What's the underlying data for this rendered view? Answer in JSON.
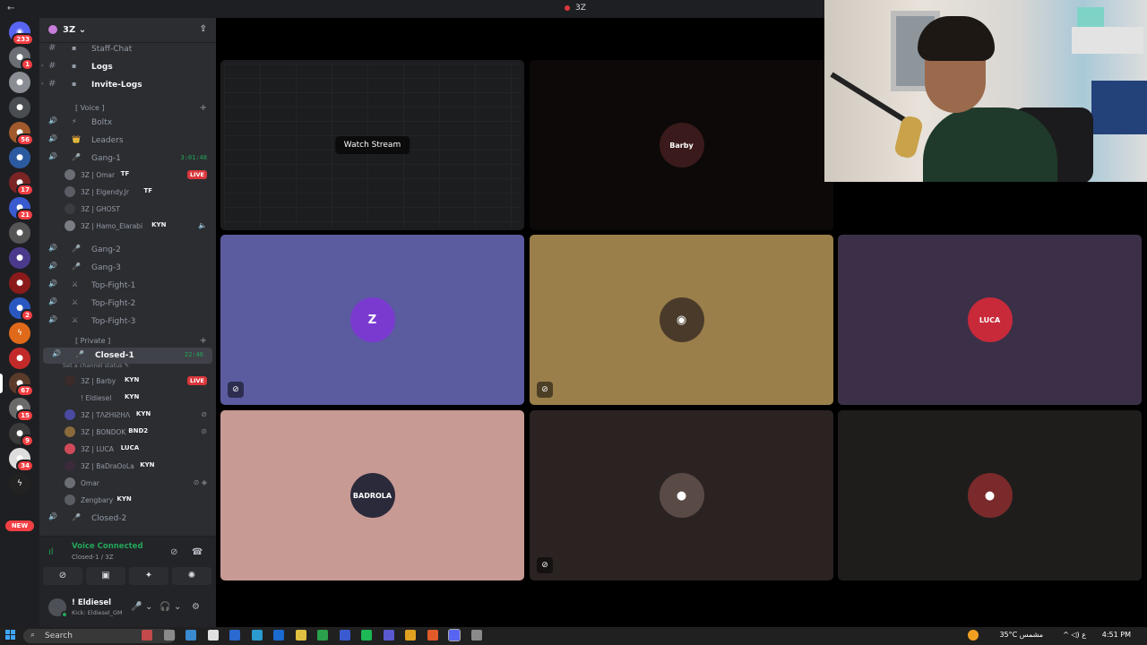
{
  "window": {
    "nav": "←",
    "title": "3Z"
  },
  "rail": {
    "servers": [
      {
        "name": "discord-home-icon",
        "badge": "233",
        "color": "#5865f2",
        "glyph": "◉"
      },
      {
        "name": "server-1",
        "badge": "1",
        "color": "#6b6e75",
        "glyph": "●"
      },
      {
        "name": "server-2",
        "badge": "",
        "color": "#8a8d93",
        "glyph": "●"
      },
      {
        "name": "server-3",
        "badge": "",
        "color": "#4a4d52",
        "glyph": "●"
      },
      {
        "name": "server-4",
        "badge": "56",
        "color": "#a05a2c",
        "glyph": "●"
      },
      {
        "name": "server-5",
        "badge": "",
        "color": "#2c5aa0",
        "glyph": "●"
      },
      {
        "name": "server-6",
        "badge": "17",
        "color": "#7a2424",
        "glyph": "●"
      },
      {
        "name": "server-7",
        "badge": "21",
        "color": "#3a5ad0",
        "glyph": "●"
      },
      {
        "name": "server-8",
        "badge": "",
        "color": "#555555",
        "glyph": "●"
      },
      {
        "name": "server-9",
        "badge": "",
        "color": "#4b3a8c",
        "glyph": "●"
      },
      {
        "name": "server-10",
        "badge": "",
        "color": "#8b1a1a",
        "glyph": "●"
      },
      {
        "name": "server-11",
        "badge": "2",
        "color": "#2a58c0",
        "glyph": "●"
      },
      {
        "name": "server-12",
        "badge": "",
        "color": "#e06a1a",
        "glyph": "ϟ"
      },
      {
        "name": "server-13",
        "badge": "",
        "color": "#c22a2a",
        "glyph": "●"
      },
      {
        "name": "server-14",
        "badge": "67",
        "color": "#5a3a2a",
        "glyph": "●"
      },
      {
        "name": "server-15",
        "badge": "15",
        "color": "#6a6a6a",
        "glyph": "●"
      },
      {
        "name": "server-16",
        "badge": "9",
        "color": "#3a3a3a",
        "glyph": "●"
      },
      {
        "name": "server-17",
        "badge": "34",
        "color": "#dddddd",
        "glyph": "●"
      },
      {
        "name": "server-18",
        "badge": "",
        "color": "#222222",
        "glyph": "ϟ"
      }
    ],
    "new_label": "NEW"
  },
  "server": {
    "name": "3Z",
    "chevron": "⌄",
    "invite_glyph": "⇪"
  },
  "channels": [
    {
      "kind": "text",
      "emoji": "▪",
      "label": "Staff-Chat",
      "bright": false,
      "arrow": "",
      "glyph": "#"
    },
    {
      "kind": "text",
      "emoji": "▪",
      "label": "Logs",
      "bright": true,
      "arrow": "›",
      "glyph": "#"
    },
    {
      "kind": "text",
      "emoji": "▪",
      "label": "Invite-Logs",
      "bright": true,
      "arrow": "›",
      "glyph": "#"
    }
  ],
  "categories": {
    "voice": "[ Voice ]",
    "private": "[ Private ]"
  },
  "voice_channels": [
    {
      "emoji": "⚡",
      "label": "Boltx",
      "glyph": "🔊"
    },
    {
      "emoji": "👑",
      "label": "Leaders",
      "glyph": "🔊"
    },
    {
      "emoji": "🎤",
      "label": "Gang-1",
      "glyph": "🔊",
      "time": "3:01:48"
    },
    {
      "emoji": "🎤",
      "label": "Gang-2",
      "glyph": "🔊"
    },
    {
      "emoji": "🎤",
      "label": "Gang-3",
      "glyph": "🔊"
    },
    {
      "emoji": "⚔",
      "label": "Top-Fight-1",
      "glyph": "🔊"
    },
    {
      "emoji": "⚔",
      "label": "Top-Fight-2",
      "glyph": "🔊"
    },
    {
      "emoji": "⚔",
      "label": "Top-Fight-3",
      "glyph": "🔊"
    },
    {
      "emoji": "🎤",
      "label": "Closed-1",
      "glyph": "🔊",
      "time": "22:46"
    },
    {
      "emoji": "🎤",
      "label": "Closed-2",
      "glyph": "🔊"
    }
  ],
  "gang1_members": [
    {
      "name": "3Z | Omar",
      "tag": "TF",
      "extra": "LIVE",
      "color": "#6b6e75"
    },
    {
      "name": "3Z | Elgendy.Jr",
      "tag": "TF",
      "extra": "",
      "color": "#5a5d63"
    },
    {
      "name": "3Z | GHOST",
      "tag": "",
      "extra": "",
      "color": "#3a3c40"
    },
    {
      "name": "3Z | Hamo_Elarabi",
      "tag": "KYN",
      "extra": "🔈",
      "color": "#7a7d83"
    }
  ],
  "closed1": {
    "status": "Set a channel status ✎"
  },
  "closed1_members": [
    {
      "name": "3Z | Barby",
      "tag": "KYN",
      "extra": "LIVE",
      "color": "#3a2a2a"
    },
    {
      "name": "! Eldiesel",
      "tag": "KYN",
      "extra": "",
      "color": "#2b2d31"
    },
    {
      "name": "3Z | ƬΛƧHIƧHΛ",
      "tag": "KYN",
      "extra": "⊘",
      "color": "#4a4aa0"
    },
    {
      "name": "3Z | BONDOK",
      "tag": "BND2",
      "extra": "⊘",
      "color": "#8a6a3a"
    },
    {
      "name": "3Z | LUCA",
      "tag": "LUCA",
      "extra": "",
      "color": "#d04a5a"
    },
    {
      "name": "3Z | BaDraOoLa",
      "tag": "KYN",
      "extra": "",
      "color": "#3a2a3a"
    },
    {
      "name": "Omar",
      "tag": "",
      "extra": "⊘ ◈",
      "color": "#6b6e75"
    },
    {
      "name": "Zengbary",
      "tag": "KYN",
      "extra": "",
      "color": "#5a5d63"
    }
  ],
  "voice_panel": {
    "title": "Voice Connected",
    "channel": "Closed-1 / 3Z",
    "icons": [
      "⊘",
      "☎"
    ],
    "buttons": [
      "⊘",
      "▣",
      "✦",
      "✺"
    ]
  },
  "user": {
    "name": "! Eldiesel",
    "status": "Kick: Eldiesel_GM",
    "icons": [
      "🎤",
      "⌄",
      "🎧",
      "⌄",
      "⚙"
    ]
  },
  "stage": {
    "watch_label": "Watch Stream",
    "tiles": [
      {
        "name": "stream-tile",
        "bg": "#1c1d1f",
        "avatar": "",
        "avbg": "#1c1d1f",
        "mic": ""
      },
      {
        "name": "barby-tile",
        "bg": "#0d0909",
        "avatar": "Barby",
        "avbg": "#3a1a1a",
        "mic": ""
      },
      {
        "name": "empty-tile",
        "bg": "#000000",
        "avatar": "",
        "avbg": "#000000",
        "mic": ""
      },
      {
        "name": "tashisha-tile",
        "bg": "#5b5ba0",
        "avatar": "Z",
        "avbg": "#7a3ad0",
        "mic": "⊘"
      },
      {
        "name": "bondok-tile",
        "bg": "#9b7f4b",
        "avatar": "◉",
        "avbg": "#4a3a2a",
        "mic": "⊘"
      },
      {
        "name": "luca-tile",
        "bg": "#3c3048",
        "avatar": "LUCA",
        "avbg": "#c82a3a",
        "mic": ""
      },
      {
        "name": "badraoola-tile",
        "bg": "#c79a94",
        "avatar": "BADROLA",
        "avbg": "#2a2a3a",
        "mic": ""
      },
      {
        "name": "omar-tile",
        "bg": "#2a2322",
        "avatar": "●",
        "avbg": "#5a4a46",
        "mic": "⊘"
      },
      {
        "name": "zengbary-tile",
        "bg": "#1e1d1c",
        "avatar": "●",
        "avbg": "#7a2a2a",
        "mic": ""
      }
    ]
  },
  "taskbar": {
    "search": "Search",
    "apps": [
      "#c24a4a",
      "#8a8a8a",
      "#3a8ad0",
      "#e0e0e0",
      "#2a6ad0",
      "#2a9ad0",
      "#1a6ad0",
      "#e0c040",
      "#2aa04a",
      "#3a5ad0",
      "#1db954",
      "#5a5ad0",
      "#e0a020",
      "#e05a2a",
      "#5865f2",
      "#8a8a8a"
    ],
    "weather": "35°C  مشمس",
    "tray": "^ ◁) ع",
    "time": "4:51 PM"
  },
  "colors": {
    "accent": "#23a559",
    "live": "#da373c",
    "discord": "#5865f2"
  }
}
